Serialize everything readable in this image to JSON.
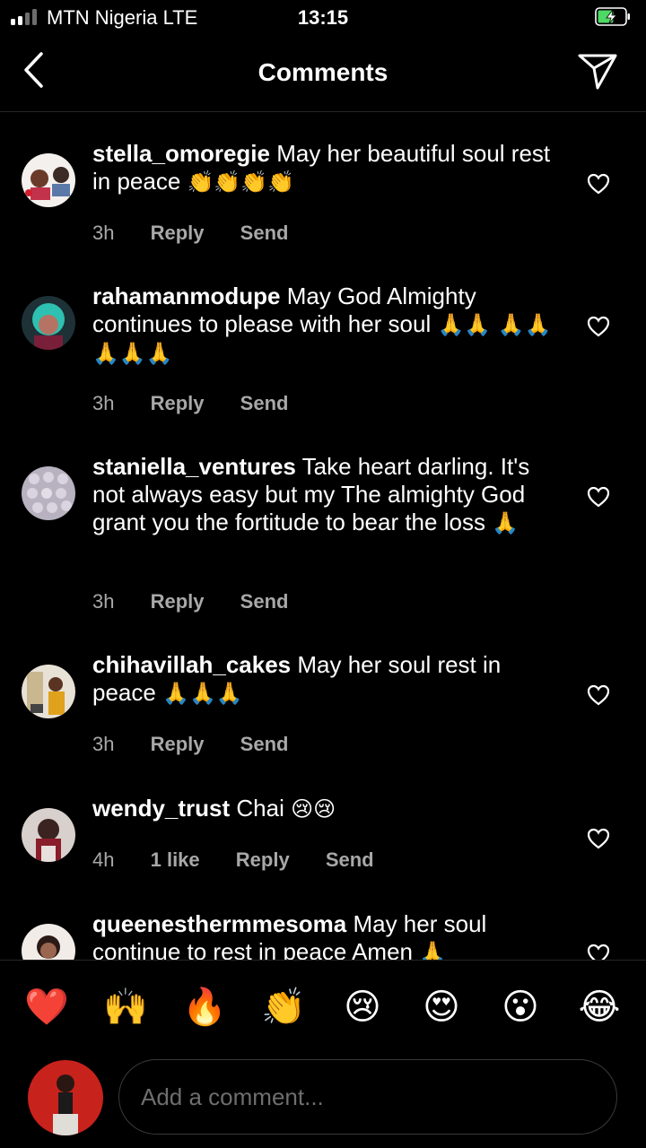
{
  "status": {
    "carrier": "MTN Nigeria  LTE",
    "time": "13:15"
  },
  "header": {
    "title": "Comments"
  },
  "comments": [
    {
      "username": "stella_omoregie",
      "text": "May her beautiful soul rest in peace",
      "emojis": "👏👏👏👏",
      "time": "3h",
      "likes": "",
      "reply": "Reply",
      "send": "Send"
    },
    {
      "username": "rahamanmodupe",
      "text": "May God Almighty continues to please with her soul",
      "emojis": "🙏🙏 🙏🙏🙏🙏🙏",
      "time": "3h",
      "likes": "",
      "reply": "Reply",
      "send": "Send"
    },
    {
      "username": "staniella_ventures",
      "text": "Take heart darling. It's not always easy but my The almighty God grant you the fortitude to bear the loss",
      "emojis": "🙏",
      "time": "3h",
      "likes": "",
      "reply": "Reply",
      "send": "Send"
    },
    {
      "username": "chihavillah_cakes",
      "text": "May her soul rest in peace",
      "emojis": "🙏🙏🙏",
      "time": "3h",
      "likes": "",
      "reply": "Reply",
      "send": "Send"
    },
    {
      "username": "wendy_trust",
      "text": "Chai",
      "emojis": "😢😢",
      "time": "4h",
      "likes": "1 like",
      "reply": "Reply",
      "send": "Send"
    },
    {
      "username": "queenesthermmesoma",
      "text": "May her soul continue to rest in peace Amen",
      "emojis": "🙏",
      "time": "",
      "likes": "",
      "reply": "",
      "send": ""
    }
  ],
  "emoji_bar": [
    "❤️",
    "🙌",
    "🔥",
    "👏",
    "😢",
    "😍",
    "😮",
    "😂"
  ],
  "input": {
    "placeholder": "Add a comment..."
  },
  "colors": {
    "background": "#000000",
    "secondary_text": "#a8a8a8",
    "divider": "#262626",
    "battery_green": "#4cd964"
  }
}
